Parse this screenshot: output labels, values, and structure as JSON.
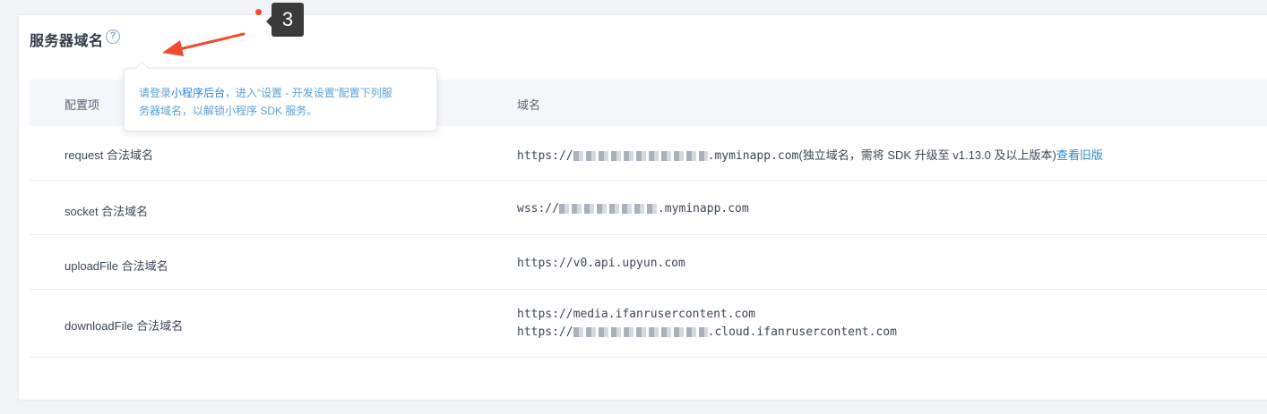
{
  "section": {
    "title": "服务器域名",
    "help_icon": "question-circle-icon"
  },
  "tooltip": {
    "prefix": "请登录",
    "link": "小程序后台",
    "suffix_line1": "，进入“设置 - 开发设置”配置下列服",
    "line2": "务器域名，以解锁小程序 SDK 服务。"
  },
  "annotation": {
    "step_number": "3",
    "arrow_color": "#f04b2e"
  },
  "table": {
    "headers": {
      "config": "配置项",
      "domain": "域名"
    },
    "rows": [
      {
        "label": "request 合法域名",
        "value_prefix": "https://",
        "value_suffix": ".myminapp.com",
        "note": "(独立域名，需将 SDK 升级至 v1.13.0 及以上版本)",
        "link": "查看旧版"
      },
      {
        "label": "socket 合法域名",
        "value_prefix": "wss://",
        "value_suffix": ".myminapp.com"
      },
      {
        "label": "uploadFile 合法域名",
        "value": "https://v0.api.upyun.com"
      },
      {
        "label": "downloadFile 合法域名",
        "value_line1": "https://media.ifanrusercontent.com",
        "value2_prefix": "https://",
        "value2_suffix": ".cloud.ifanrusercontent.com"
      }
    ]
  },
  "colors": {
    "accent": "#2b86d9",
    "background": "#f1f3f7"
  }
}
